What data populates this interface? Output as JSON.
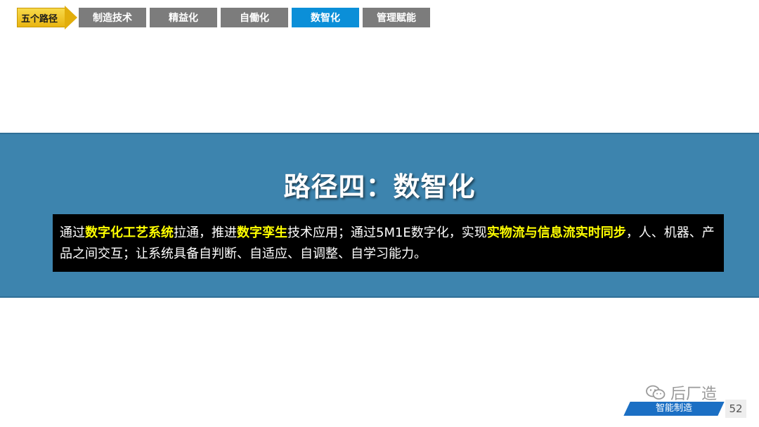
{
  "nav": {
    "badge_label": "五个路径",
    "tabs": [
      {
        "label": "制造技术",
        "active": false
      },
      {
        "label": "精益化",
        "active": false
      },
      {
        "label": "自働化",
        "active": false
      },
      {
        "label": "数智化",
        "active": true
      },
      {
        "label": "管理赋能",
        "active": false
      }
    ]
  },
  "main": {
    "title": "路径四：数智化",
    "description": [
      {
        "text": "通过",
        "highlight": false
      },
      {
        "text": "数字化工艺系统",
        "highlight": true
      },
      {
        "text": "拉通，推进",
        "highlight": false
      },
      {
        "text": "数字孪生",
        "highlight": true
      },
      {
        "text": "技术应用；通过5M1E数字化，实现",
        "highlight": false
      },
      {
        "text": "实物流与信息流实时同步",
        "highlight": true
      },
      {
        "text": "，人、机器、产品之间交互；让系统具备自判断、自适应、自调整、自学习能力。",
        "highlight": false
      }
    ]
  },
  "footer": {
    "watermark_icon": "wechat-icon",
    "watermark_text": "后厂造",
    "tag_label": "智能制造",
    "page_number": "52"
  },
  "colors": {
    "band": "#3d84ae",
    "active_tab": "#0b8fd8",
    "inactive_tab": "#7c7c7c",
    "highlight": "#ffff00",
    "badge": "#e9b511"
  }
}
